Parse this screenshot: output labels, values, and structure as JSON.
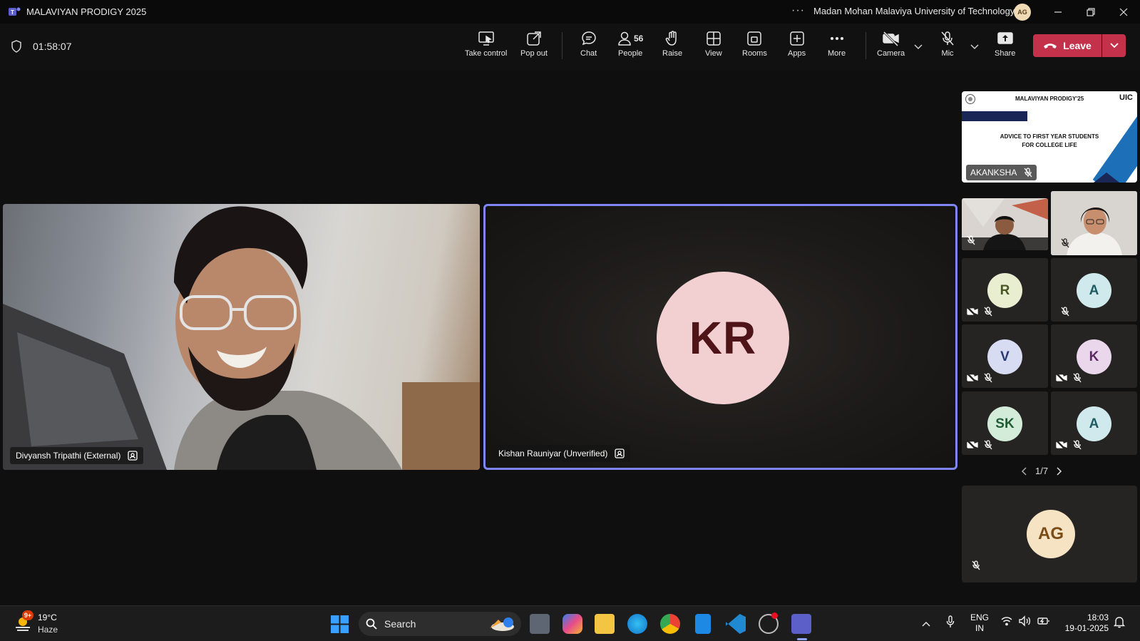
{
  "titlebar": {
    "app_title": "MALAVIYAN PRODIGY 2025",
    "more_label": "···",
    "org_name": "Madan Mohan Malaviya University of Technology",
    "user_initials": "AG"
  },
  "toolbar": {
    "timer": "01:58:07",
    "buttons": {
      "take_control": "Take control",
      "pop_out": "Pop out",
      "chat": "Chat",
      "people": "People",
      "people_count": "56",
      "raise": "Raise",
      "view": "View",
      "rooms": "Rooms",
      "apps": "Apps",
      "more": "More",
      "camera": "Camera",
      "mic": "Mic",
      "share": "Share",
      "leave": "Leave"
    }
  },
  "stage": {
    "tile_divyansh": {
      "name": "Divyansh Tripathi (External)"
    },
    "tile_kishan": {
      "name": "Kishan Rauniyar (Unverified)",
      "initials": "KR"
    },
    "tile_akanksha": {
      "name": "AKANKSHA",
      "slide_title": "MALAVIYAN PRODIGY'25",
      "slide_logo_text": "UIC",
      "slide_line1": "ADVICE TO FIRST YEAR STUDENTS",
      "slide_line2": "FOR COLLEGE LIFE"
    },
    "gallery": [
      {
        "initials": "R"
      },
      {
        "initials": "A"
      },
      {
        "initials": "V"
      },
      {
        "initials": "K"
      },
      {
        "initials": "SK"
      },
      {
        "initials": "A"
      }
    ],
    "pager": "1/7",
    "self_tile": {
      "initials": "AG"
    }
  },
  "taskbar": {
    "temperature": "19°C",
    "weather": "Haze",
    "weather_badge": "9+",
    "search_label": "Search",
    "lang_line1": "ENG",
    "lang_line2": "IN",
    "time": "18:03",
    "date": "19-01-2025"
  },
  "colors": {
    "accent_border": "#7f85f5",
    "leave_red": "#c4314b"
  }
}
